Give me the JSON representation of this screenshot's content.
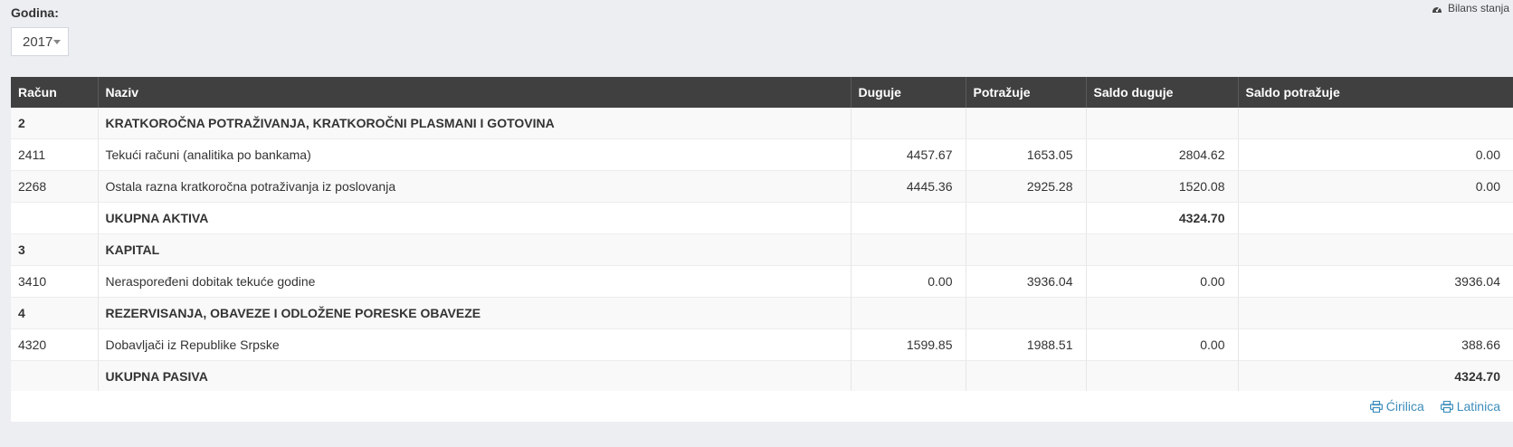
{
  "filter": {
    "label": "Godina:",
    "year_value": "2017"
  },
  "breadcrumb": {
    "icon": "dashboard-icon",
    "label": "Bilans stanja"
  },
  "table": {
    "headers": [
      "Račun",
      "Naziv",
      "Duguje",
      "Potražuje",
      "Saldo duguje",
      "Saldo potražuje"
    ],
    "rows": [
      {
        "racun": "2",
        "naziv": "KRATKOROČNA POTRAŽIVANJA, KRATKOROČNI PLASMANI I GOTOVINA",
        "duguje": "",
        "potrazuje": "",
        "saldo_duguje": "",
        "saldo_potrazuje": ""
      },
      {
        "racun": "2411",
        "naziv": "Tekući računi (analitika po bankama)",
        "duguje": "4457.67",
        "potrazuje": "1653.05",
        "saldo_duguje": "2804.62",
        "saldo_potrazuje": "0.00"
      },
      {
        "racun": "2268",
        "naziv": "Ostala razna kratkoročna potraživanja iz poslovanja",
        "duguje": "4445.36",
        "potrazuje": "2925.28",
        "saldo_duguje": "1520.08",
        "saldo_potrazuje": "0.00"
      },
      {
        "racun": "",
        "naziv": "UKUPNA AKTIVA",
        "duguje": "",
        "potrazuje": "",
        "saldo_duguje": "4324.70",
        "saldo_potrazuje": ""
      },
      {
        "racun": "3",
        "naziv": "KAPITAL",
        "duguje": "",
        "potrazuje": "",
        "saldo_duguje": "",
        "saldo_potrazuje": ""
      },
      {
        "racun": "3410",
        "naziv": "Neraspoređeni dobitak tekuće godine",
        "duguje": "0.00",
        "potrazuje": "3936.04",
        "saldo_duguje": "0.00",
        "saldo_potrazuje": "3936.04"
      },
      {
        "racun": "4",
        "naziv": "REZERVISANJA, OBAVEZE I ODLOŽENE PORESKE OBAVEZE",
        "duguje": "",
        "potrazuje": "",
        "saldo_duguje": "",
        "saldo_potrazuje": ""
      },
      {
        "racun": "4320",
        "naziv": "Dobavljači iz Republike Srpske",
        "duguje": "1599.85",
        "potrazuje": "1988.51",
        "saldo_duguje": "0.00",
        "saldo_potrazuje": "388.66"
      },
      {
        "racun": "",
        "naziv": "UKUPNA PASIVA",
        "duguje": "",
        "potrazuje": "",
        "saldo_duguje": "",
        "saldo_potrazuje": "4324.70"
      }
    ]
  },
  "print_links": {
    "icon": "print-icon",
    "cirilica": "Ćirilica",
    "latinica": "Latinica"
  }
}
